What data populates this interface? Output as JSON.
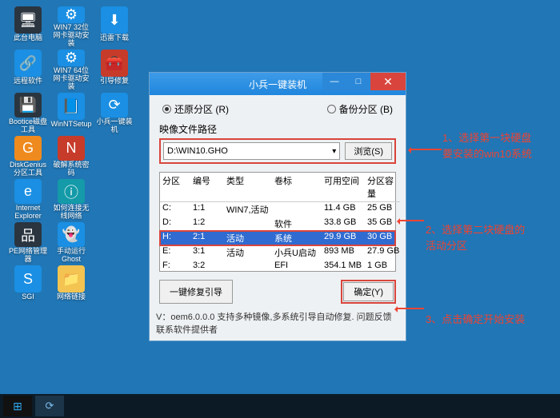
{
  "desktop_icons": [
    {
      "label": "此台电脑",
      "glyph": "🖥",
      "cls": "c-dark"
    },
    {
      "label": "WIN7 32位网卡驱动安装",
      "glyph": "⚙",
      "cls": "c-blue"
    },
    {
      "label": "迅雷下载",
      "glyph": "⬇",
      "cls": "c-blue"
    },
    {
      "label": "",
      "glyph": "",
      "cls": ""
    },
    {
      "label": "远程软件",
      "glyph": "🔗",
      "cls": "c-blue"
    },
    {
      "label": "WIN7 64位网卡驱动安装",
      "glyph": "⚙",
      "cls": "c-blue"
    },
    {
      "label": "引导修复",
      "glyph": "🧰",
      "cls": "c-red"
    },
    {
      "label": "",
      "glyph": "",
      "cls": ""
    },
    {
      "label": "Bootice磁盘工具",
      "glyph": "💾",
      "cls": "c-dark"
    },
    {
      "label": "WinNTSetup",
      "glyph": "📘",
      "cls": "c-blue"
    },
    {
      "label": "小兵一键装机",
      "glyph": "⟳",
      "cls": "c-blue"
    },
    {
      "label": "",
      "glyph": "",
      "cls": ""
    },
    {
      "label": "DiskGenius分区工具",
      "glyph": "G",
      "cls": "c-orange"
    },
    {
      "label": "破解系统密码",
      "glyph": "N",
      "cls": "c-red"
    },
    {
      "label": "",
      "glyph": "",
      "cls": ""
    },
    {
      "label": "",
      "glyph": "",
      "cls": ""
    },
    {
      "label": "Internet Explorer",
      "glyph": "e",
      "cls": "c-blue"
    },
    {
      "label": "如何连接无线网络",
      "glyph": "ⓘ",
      "cls": "c-teal"
    },
    {
      "label": "",
      "glyph": "",
      "cls": ""
    },
    {
      "label": "",
      "glyph": "",
      "cls": ""
    },
    {
      "label": "PE网络管理器",
      "glyph": "品",
      "cls": "c-dark"
    },
    {
      "label": "手动运行Ghost",
      "glyph": "👻",
      "cls": "c-blue"
    },
    {
      "label": "",
      "glyph": "",
      "cls": ""
    },
    {
      "label": "",
      "glyph": "",
      "cls": ""
    },
    {
      "label": "SGI",
      "glyph": "S",
      "cls": "c-blue"
    },
    {
      "label": "网络链接",
      "glyph": "📁",
      "cls": "c-folder"
    }
  ],
  "dialog": {
    "title": "小兵一键装机",
    "radio_restore": "还原分区 (R)",
    "radio_backup": "备份分区 (B)",
    "image_path_label": "映像文件路径",
    "image_path_value": "D:\\WIN10.GHO",
    "browse": "浏览(S)",
    "headers": [
      "分区",
      "编号",
      "类型",
      "卷标",
      "可用空间",
      "分区容量"
    ],
    "rows": [
      {
        "p": "C:",
        "n": "1:1",
        "t": "WIN7,活动",
        "v": "",
        "free": "11.4 GB",
        "cap": "25 GB",
        "sel": false
      },
      {
        "p": "D:",
        "n": "1:2",
        "t": "",
        "v": "软件",
        "free": "33.8 GB",
        "cap": "35 GB",
        "sel": false
      },
      {
        "p": "H:",
        "n": "2:1",
        "t": "活动",
        "v": "系统",
        "free": "29.9 GB",
        "cap": "30 GB",
        "sel": true
      },
      {
        "p": "E:",
        "n": "3:1",
        "t": "活动",
        "v": "小兵U启动",
        "free": "893 MB",
        "cap": "27.9 GB",
        "sel": false
      },
      {
        "p": "F:",
        "n": "3:2",
        "t": "",
        "v": "EFI",
        "free": "354.1 MB",
        "cap": "1 GB",
        "sel": false
      }
    ],
    "repair_btn": "一键修复引导",
    "ok_btn": "确定(Y)",
    "status": "V：oem6.0.0.0    支持多种镜像,多系统引导自动修复. 问题反馈联系软件提供者"
  },
  "annotations": {
    "a1_l1": "1、选择第一块硬盘",
    "a1_l2": "要安装的win10系统",
    "a2_l1": "2、选择第二块硬盘的",
    "a2_l2": "活动分区",
    "a3": "3、点击确定开始安装"
  }
}
